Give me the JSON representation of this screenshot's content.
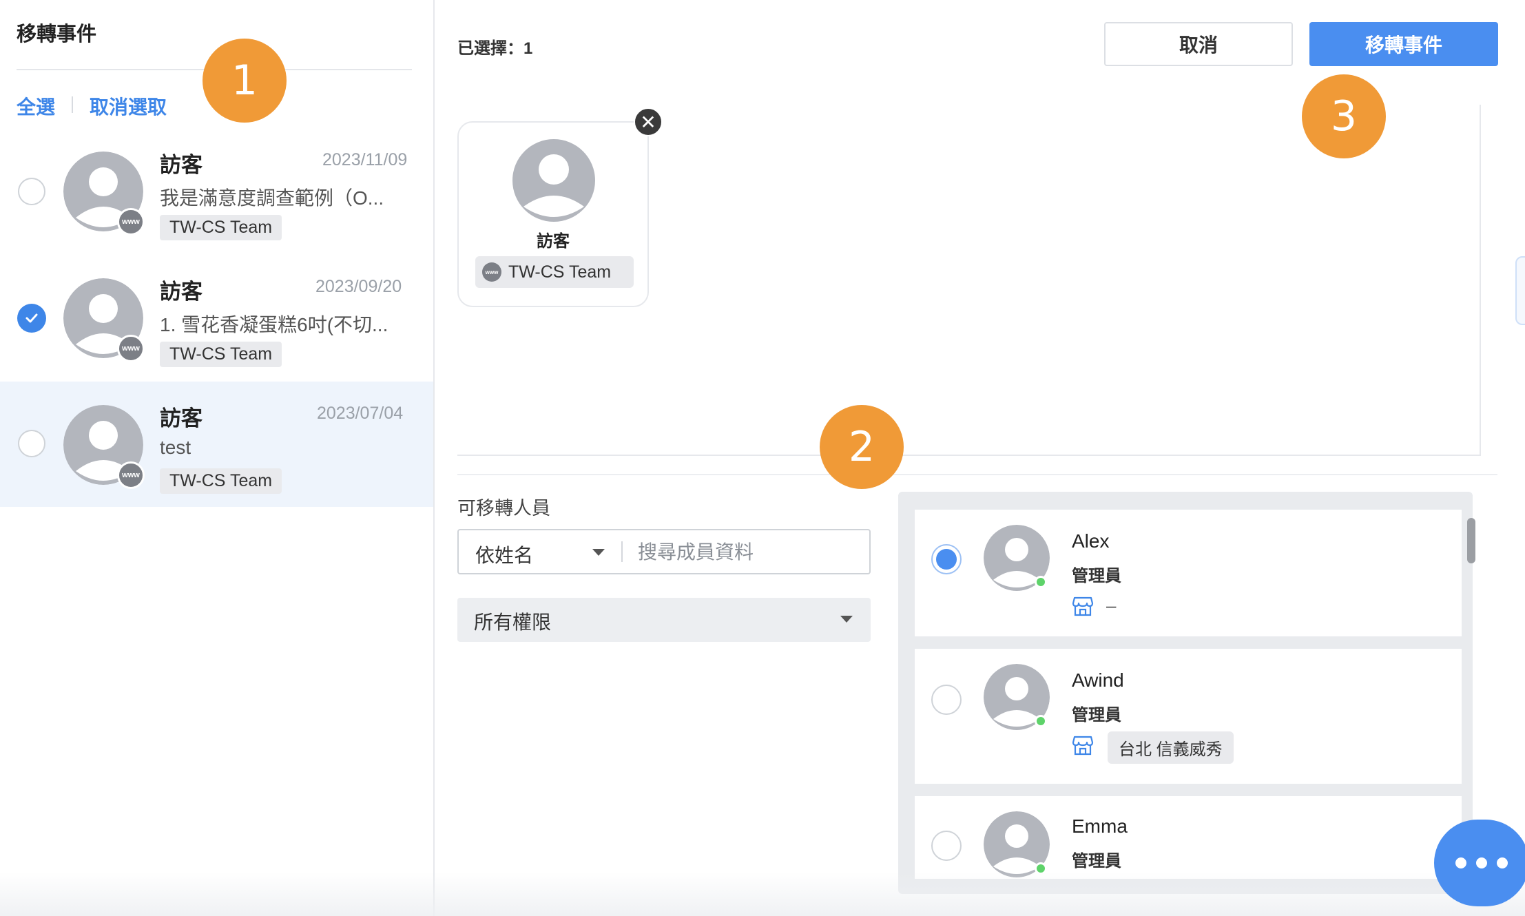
{
  "left_panel": {
    "title": "移轉事件",
    "select_all": "全選",
    "deselect": "取消選取",
    "badge_text": "www",
    "conversations": [
      {
        "name": "訪客",
        "date": "2023/11/09",
        "preview": "我是滿意度調查範例（O...",
        "tag": "TW-CS Team",
        "checked": false
      },
      {
        "name": "訪客",
        "date": "2023/09/20",
        "preview": "1. 雪花香凝蛋糕6吋(不切...",
        "tag": "TW-CS Team",
        "checked": true
      },
      {
        "name": "訪客",
        "date": "2023/07/04",
        "preview": "test",
        "tag": "TW-CS Team",
        "checked": false
      }
    ]
  },
  "header": {
    "selected_count": "已選擇：1",
    "cancel_label": "取消",
    "transfer_label": "移轉事件"
  },
  "selected_card": {
    "name": "訪客",
    "tag": "TW-CS Team",
    "close_glyph": "✕"
  },
  "filters": {
    "section_label": "可移轉人員",
    "sort_value": "依姓名",
    "search_placeholder": "搜尋成員資料",
    "role_value": "所有權限"
  },
  "members": [
    {
      "name": "Alex",
      "role": "管理員",
      "store": "–",
      "selected": true,
      "online": true
    },
    {
      "name": "Awind",
      "role": "管理員",
      "store": "台北 信義威秀",
      "selected": false,
      "online": true
    },
    {
      "name": "Emma",
      "role": "管理員",
      "store": "",
      "selected": false,
      "online": true
    }
  ],
  "markers": [
    "1",
    "2",
    "3"
  ],
  "icons": {
    "avatar": "person-avatar-icon",
    "store": "store-icon",
    "close": "close-icon",
    "chat": "chat-more-icon",
    "check": "check-icon",
    "caret": "caret-down-icon"
  },
  "colors": {
    "accent": "#4a8ef0",
    "link": "#3e86e8",
    "marker": "#f09a37",
    "online": "#5ed36a",
    "selected_row": "#eef4fc"
  }
}
